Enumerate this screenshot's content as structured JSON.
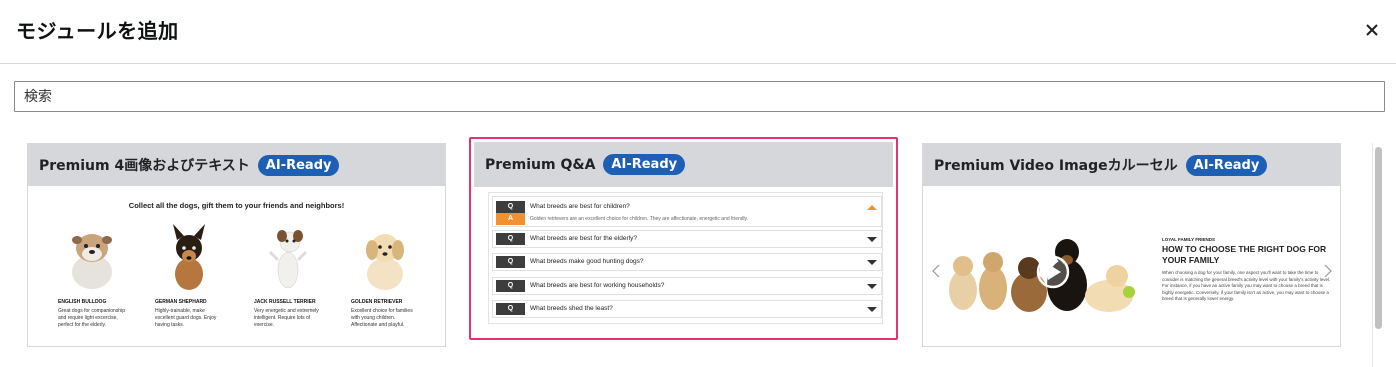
{
  "dialog": {
    "title": "モジュールを追加",
    "close_icon": "close-icon"
  },
  "search": {
    "placeholder": "検索",
    "value": ""
  },
  "colors": {
    "badge": "#1c5fb5",
    "selected_border": "#e3336f",
    "card_header": "#d5d7da",
    "accent": "#f29132"
  },
  "cards": [
    {
      "title": "Premium 4画像およびテキスト",
      "badge": "AI-Ready",
      "preview": {
        "headline": "Collect all the dogs, gift them to your friends and neighbors!",
        "items": [
          {
            "name": "ENGLISH BULLDOG",
            "desc": "Great dogs for companionship and require light excercise, perfect for the elderly."
          },
          {
            "name": "GERMAN SHEPHARD",
            "desc": "Highly-trainable, make excellent guard dogs. Enjoy having tasks."
          },
          {
            "name": "JACK RUSSELL TERRIER",
            "desc": "Very energetic and extremely intelligent. Require lots of exercise."
          },
          {
            "name": "GOLDEN RETRIEVER",
            "desc": "Excellent choice for families with young children. Affectionate and playful."
          }
        ]
      }
    },
    {
      "title": "Premium Q&A",
      "badge": "AI-Ready",
      "selected": true,
      "preview": {
        "q_label": "Q",
        "a_label": "A",
        "items": [
          {
            "question": "What breeds are best for children?",
            "answer": "Golden retrievers are an excellent choice for children. They are affectionate, energetic and friendly."
          },
          {
            "question": "What breeds are best for the elderly?"
          },
          {
            "question": "What breeds make good hunting dogs?"
          },
          {
            "question": "What breeds are best for working households?"
          },
          {
            "question": "What breeds shed the least?"
          }
        ]
      }
    },
    {
      "title": "Premium Video Imageカルーセル",
      "badge": "AI-Ready",
      "preview": {
        "eyebrow": "LOYAL FAMILY FRIENDS",
        "headline": "HOW TO CHOOSE THE RIGHT DOG FOR YOUR FAMILY",
        "body": "When choosing a dog for your family, one aspect you'll want to take the time to consider is matching the general breed's activity level with your family's activity level. For instance, if you have an active family you may want to choose a breed that is highly energetic. Conversely, if your family isn't as active, you may want to choose a breed that is generally lower energy.",
        "slide_count": 4,
        "active_slide": 2
      }
    }
  ]
}
